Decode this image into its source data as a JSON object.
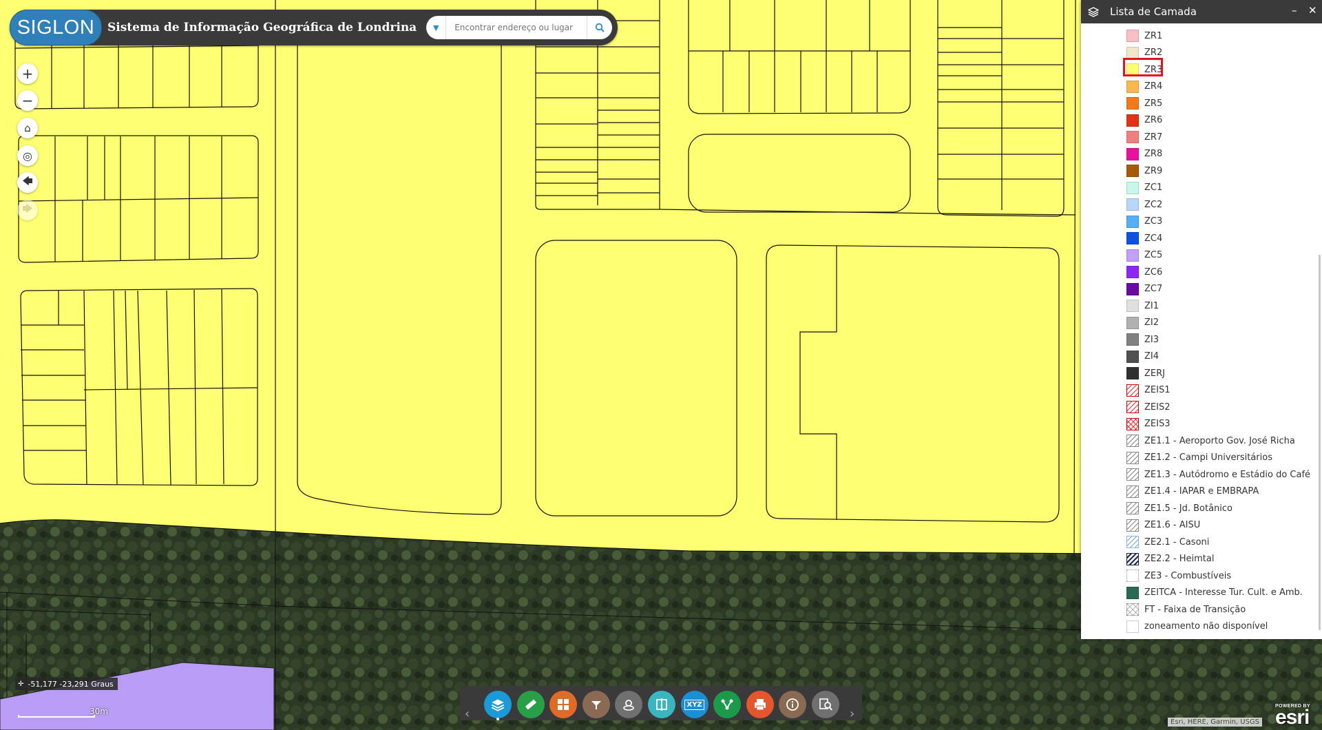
{
  "app": {
    "logo_text": "SIGLON",
    "title": "Sistema de Informação Geográfica de Londrina",
    "search_placeholder": "Encontrar endereço ou lugar"
  },
  "map_tools": [
    {
      "label": "+",
      "icon": "zoom-in-icon"
    },
    {
      "label": "−",
      "icon": "zoom-out-icon"
    },
    {
      "label": "⌂",
      "icon": "home-icon"
    },
    {
      "label": "◎",
      "icon": "locate-icon"
    },
    {
      "label": "🡄",
      "icon": "back-icon"
    },
    {
      "label": "🡆",
      "icon": "forward-icon"
    }
  ],
  "layer_panel": {
    "title": "Lista de Camada",
    "highlighted_item": "ZR3",
    "items": [
      {
        "label": "ZR1",
        "color": "#f6c0c4",
        "style": "solid"
      },
      {
        "label": "ZR2",
        "color": "#f0e6c8",
        "style": "solid"
      },
      {
        "label": "ZR3",
        "color": "#ffff73",
        "style": "solid"
      },
      {
        "label": "ZR4",
        "color": "#f8b84e",
        "style": "solid"
      },
      {
        "label": "ZR5",
        "color": "#f07a1c",
        "style": "solid"
      },
      {
        "label": "ZR6",
        "color": "#e03416",
        "style": "solid"
      },
      {
        "label": "ZR7",
        "color": "#f08080",
        "style": "solid"
      },
      {
        "label": "ZR8",
        "color": "#e8109e",
        "style": "solid"
      },
      {
        "label": "ZR9",
        "color": "#a85a0a",
        "style": "solid"
      },
      {
        "label": "ZC1",
        "color": "#c8f8ec",
        "style": "solid"
      },
      {
        "label": "ZC2",
        "color": "#b8d6f8",
        "style": "solid"
      },
      {
        "label": "ZC3",
        "color": "#56aef4",
        "style": "solid"
      },
      {
        "label": "ZC4",
        "color": "#0c54e0",
        "style": "solid"
      },
      {
        "label": "ZC5",
        "color": "#c0a0f8",
        "style": "solid"
      },
      {
        "label": "ZC6",
        "color": "#8c28f0",
        "style": "solid"
      },
      {
        "label": "ZC7",
        "color": "#6a0aa0",
        "style": "solid"
      },
      {
        "label": "ZI1",
        "color": "#e0e0e0",
        "style": "solid"
      },
      {
        "label": "ZI2",
        "color": "#b0b0b0",
        "style": "solid"
      },
      {
        "label": "ZI3",
        "color": "#808080",
        "style": "solid"
      },
      {
        "label": "ZI4",
        "color": "#505050",
        "style": "solid"
      },
      {
        "label": "ZERJ",
        "color": "#303030",
        "style": "solid"
      },
      {
        "label": "ZEIS1",
        "color": "#e33",
        "style": "zeis"
      },
      {
        "label": "ZEIS2",
        "color": "#e33",
        "style": "zeis"
      },
      {
        "label": "ZEIS3",
        "color": "#e33",
        "style": "zeis3"
      },
      {
        "label": "ZE1.1 - Aeroporto Gov. José Richa",
        "color": "#888",
        "style": "ze"
      },
      {
        "label": "ZE1.2 - Campi Universitários",
        "color": "#888",
        "style": "ze"
      },
      {
        "label": "ZE1.3 - Autódromo e Estádio do Café",
        "color": "#888",
        "style": "ze"
      },
      {
        "label": "ZE1.4 - IAPAR e EMBRAPA",
        "color": "#888",
        "style": "ze"
      },
      {
        "label": "ZE1.5 - Jd. Botânico",
        "color": "#888",
        "style": "ze"
      },
      {
        "label": "ZE1.6 - AISU",
        "color": "#888",
        "style": "ze"
      },
      {
        "label": "ZE2.1 - Casoni",
        "color": "#6fa8e0",
        "style": "casoni"
      },
      {
        "label": "ZE2.2 - Heimtal",
        "color": "#1a2a55",
        "style": "heimtal"
      },
      {
        "label": "ZE3 - Combustíveis",
        "color": "#999",
        "style": "dot"
      },
      {
        "label": "ZEITCA - Interesse Tur. Cult. e Amb.",
        "color": "#2a6a52",
        "style": "solid"
      },
      {
        "label": "FT - Faixa de Transição",
        "color": "#999",
        "style": "ft"
      },
      {
        "label": "zoneamento não disponível",
        "color": "#ffffff",
        "style": "none"
      }
    ]
  },
  "bottom_toolbar": [
    {
      "name": "layer-list-tool",
      "icon": "layers-icon",
      "color": "#1a9ad6"
    },
    {
      "name": "measure-tool",
      "icon": "ruler-icon",
      "color": "#27a047"
    },
    {
      "name": "basemap-gallery-tool",
      "icon": "grid-icon",
      "color": "#e06a28"
    },
    {
      "name": "filter-tool",
      "icon": "filter-icon",
      "color": "#8a6a52"
    },
    {
      "name": "draw-tool",
      "icon": "draw-icon",
      "color": "#707070"
    },
    {
      "name": "swipe-tool",
      "icon": "swipe-icon",
      "color": "#3ab6c0"
    },
    {
      "name": "coordinate-tool",
      "icon": "xyz-icon",
      "label": "XYZ",
      "color": "#1a8fd6"
    },
    {
      "name": "share-tool",
      "icon": "share-icon",
      "color": "#1a9a4a"
    },
    {
      "name": "print-tool",
      "icon": "print-icon",
      "color": "#e4572e"
    },
    {
      "name": "about-tool",
      "icon": "info-icon",
      "color": "#8a6a52"
    },
    {
      "name": "query-tool",
      "icon": "search-map-icon",
      "color": "#707070"
    }
  ],
  "status": {
    "coordinates": "-51,177 -23,291 Graus",
    "scale_label": "30m",
    "attribution": "Esri, HERE, Garmin, USGS",
    "esri_powered": "POWERED BY",
    "esri_name": "esri"
  }
}
